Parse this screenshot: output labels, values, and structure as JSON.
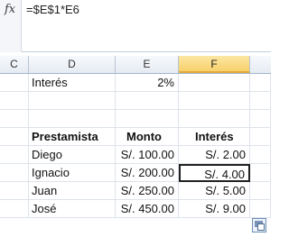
{
  "formula_bar": {
    "fx_label": "fx",
    "formula": "=$E$1*E6"
  },
  "columns": [
    "C",
    "D",
    "E",
    "F"
  ],
  "selected_column": "F",
  "cells": {
    "interes_label": "Interés",
    "interes_rate": "2%",
    "header_prestamista": "Prestamista",
    "header_monto": "Monto",
    "header_interes": "Interés"
  },
  "rows": [
    {
      "prestamista": "Diego",
      "monto": "S/. 100.00",
      "interes": "S/. 2.00"
    },
    {
      "prestamista": "Ignacio",
      "monto": "S/. 200.00",
      "interes": "S/. 4.00"
    },
    {
      "prestamista": "Juan",
      "monto": "S/. 250.00",
      "interes": "S/. 5.00"
    },
    {
      "prestamista": "José",
      "monto": "S/. 450.00",
      "interes": "S/. 9.00"
    }
  ],
  "icons": {
    "formula": "fx-icon",
    "paste_options": "paste-options-icon"
  },
  "colors": {
    "selected_column_header": "#f8d16b",
    "gridline": "#dde2ea"
  }
}
